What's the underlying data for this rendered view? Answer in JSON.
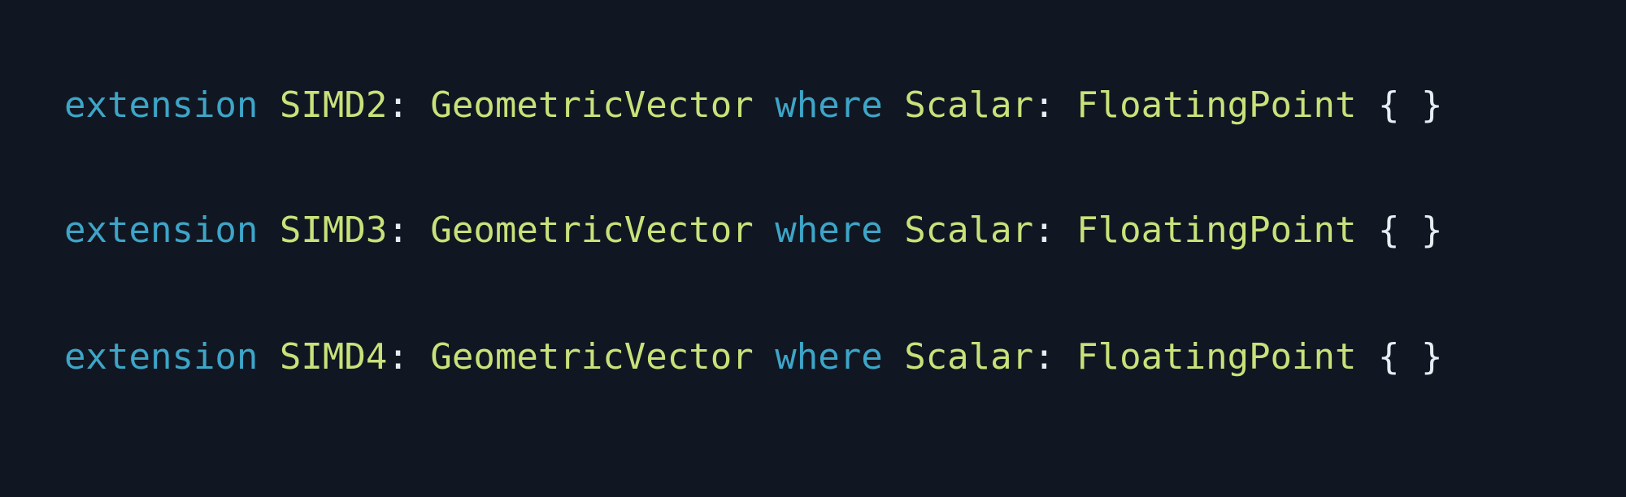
{
  "colors": {
    "background": "#111722",
    "keyword": "#3da5c8",
    "type": "#c8e27a",
    "punctuation": "#e6edf3"
  },
  "code_lines": [
    {
      "keyword_extension": "extension",
      "space_1": " ",
      "type_name": "SIMD2",
      "colon_1": ":",
      "space_2": " ",
      "protocol": "GeometricVector",
      "space_3": " ",
      "keyword_where": "where",
      "space_4": " ",
      "constraint_name": "Scalar",
      "colon_2": ":",
      "space_5": " ",
      "constraint_type": "FloatingPoint",
      "space_6": " ",
      "braces": "{ }"
    },
    {
      "keyword_extension": "extension",
      "space_1": " ",
      "type_name": "SIMD3",
      "colon_1": ":",
      "space_2": " ",
      "protocol": "GeometricVector",
      "space_3": " ",
      "keyword_where": "where",
      "space_4": " ",
      "constraint_name": "Scalar",
      "colon_2": ":",
      "space_5": " ",
      "constraint_type": "FloatingPoint",
      "space_6": " ",
      "braces": "{ }"
    },
    {
      "keyword_extension": "extension",
      "space_1": " ",
      "type_name": "SIMD4",
      "colon_1": ":",
      "space_2": " ",
      "protocol": "GeometricVector",
      "space_3": " ",
      "keyword_where": "where",
      "space_4": " ",
      "constraint_name": "Scalar",
      "colon_2": ":",
      "space_5": " ",
      "constraint_type": "FloatingPoint",
      "space_6": " ",
      "braces": "{ }"
    }
  ]
}
